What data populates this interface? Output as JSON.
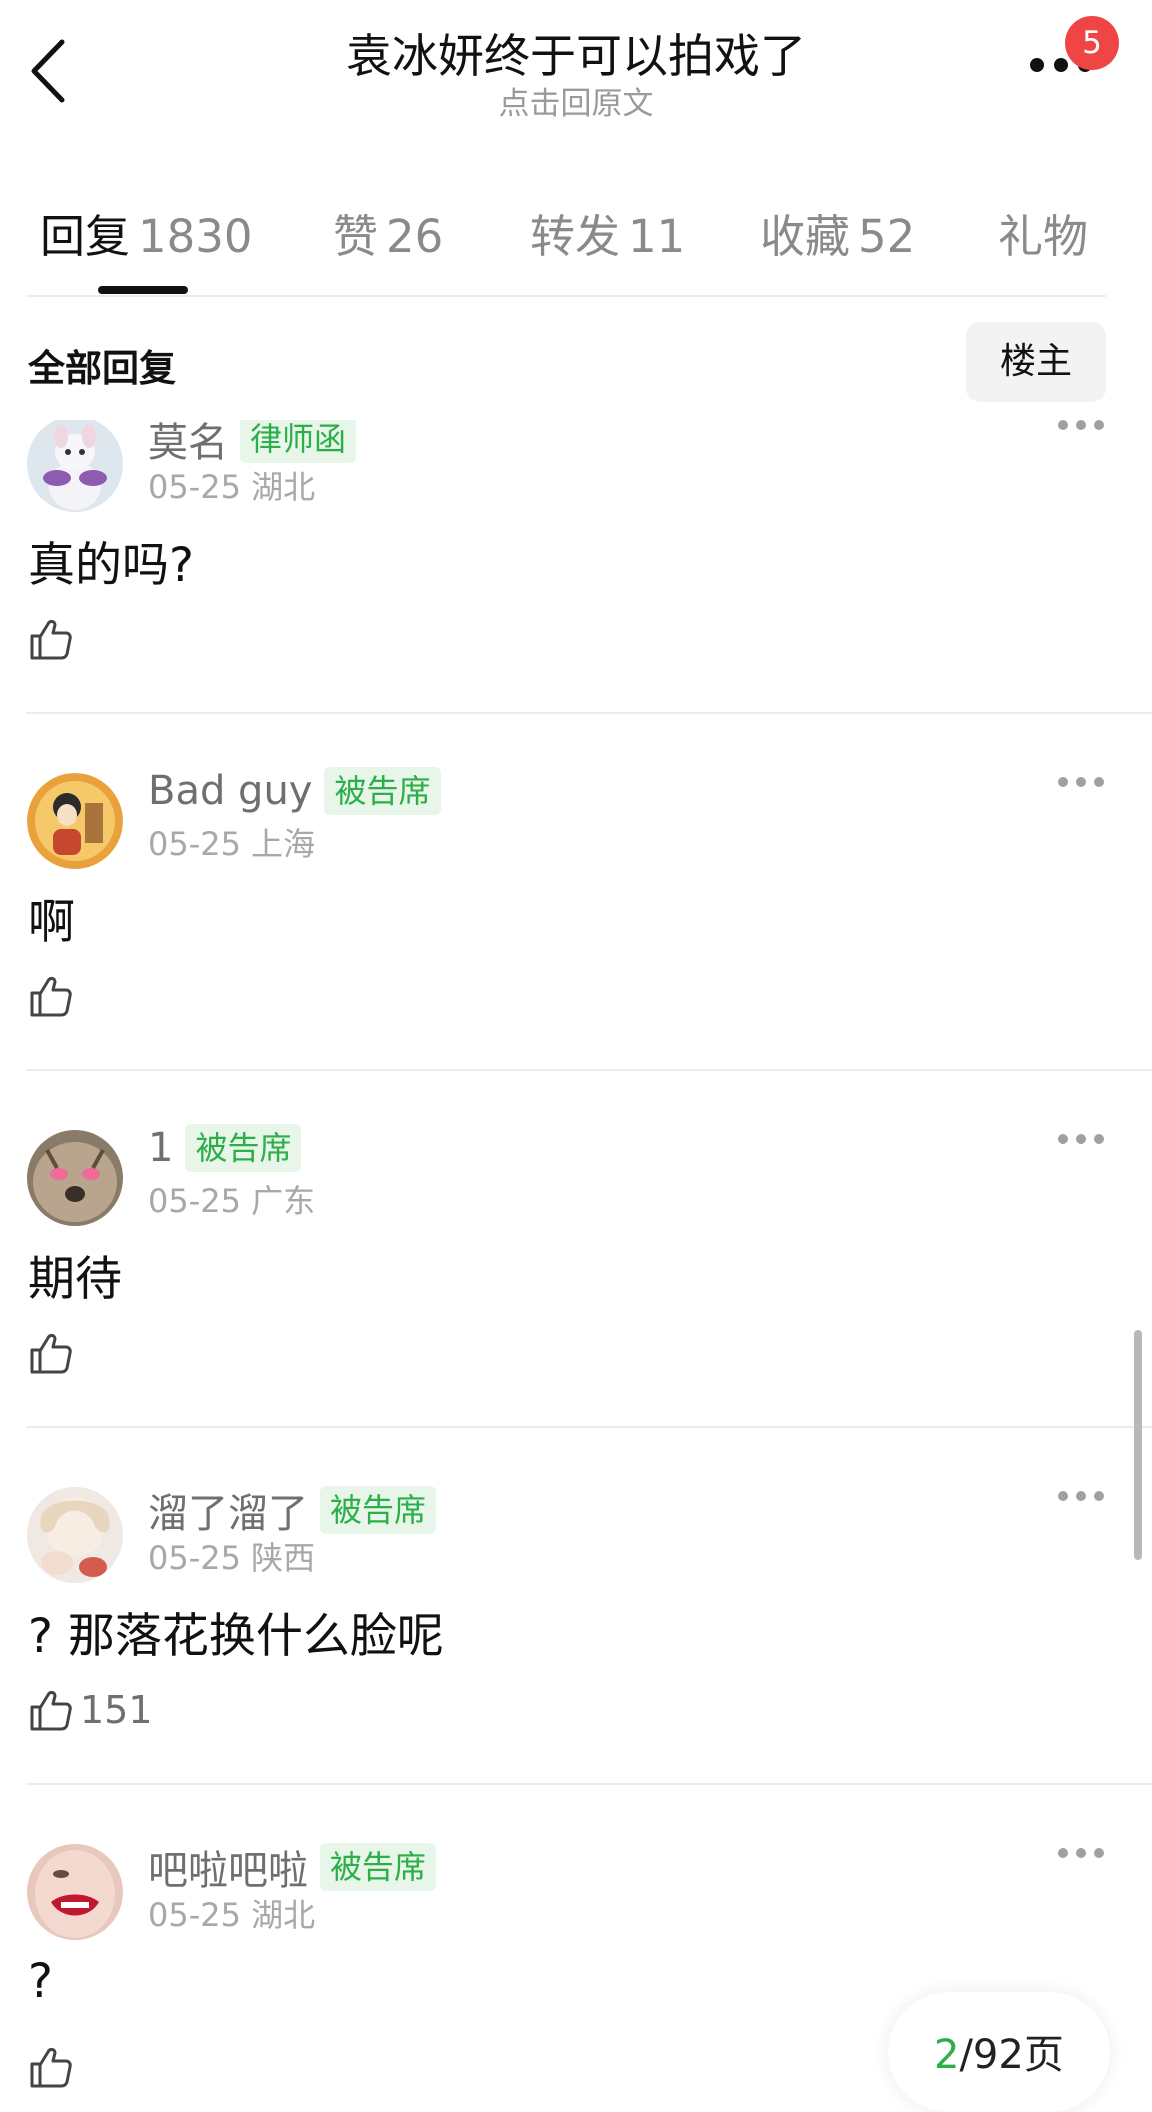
{
  "header": {
    "title": "袁冰妍终于可以拍戏了",
    "subtitle": "点击回原文",
    "notification_count": "5"
  },
  "tabs": [
    {
      "label": "回复",
      "count": "1830",
      "active": true
    },
    {
      "label": "赞",
      "count": "26"
    },
    {
      "label": "转发",
      "count": "11"
    },
    {
      "label": "收藏",
      "count": "52"
    },
    {
      "label": "礼物",
      "count": ""
    }
  ],
  "section": {
    "title": "全部回复",
    "op_button": "楼主"
  },
  "comments": [
    {
      "name": "莫名",
      "tag": "律师函",
      "date": "05-25",
      "location": "湖北",
      "text": "真的吗?",
      "likes": ""
    },
    {
      "name": "Bad guy",
      "tag": "被告席",
      "date": "05-25",
      "location": "上海",
      "text": "啊",
      "likes": ""
    },
    {
      "name": "1",
      "tag": "被告席",
      "date": "05-25",
      "location": "广东",
      "text": "期待",
      "likes": ""
    },
    {
      "name": "溜了溜了",
      "tag": "被告席",
      "date": "05-25",
      "location": "陕西",
      "text": "? 那落花换什么脸呢",
      "likes": "151"
    },
    {
      "name": "吧啦吧啦",
      "tag": "被告席",
      "date": "05-25",
      "location": "湖北",
      "text": "?",
      "likes": ""
    }
  ],
  "pager": {
    "current": "2",
    "total": "/92页"
  },
  "colors": {
    "accent_green": "#2cae48",
    "tag_background": "#e8f6e9",
    "badge_red": "#f04545"
  },
  "icons": {
    "back": "chevron-left-icon",
    "more": "more-dots-icon",
    "like": "thumbs-up-icon"
  }
}
